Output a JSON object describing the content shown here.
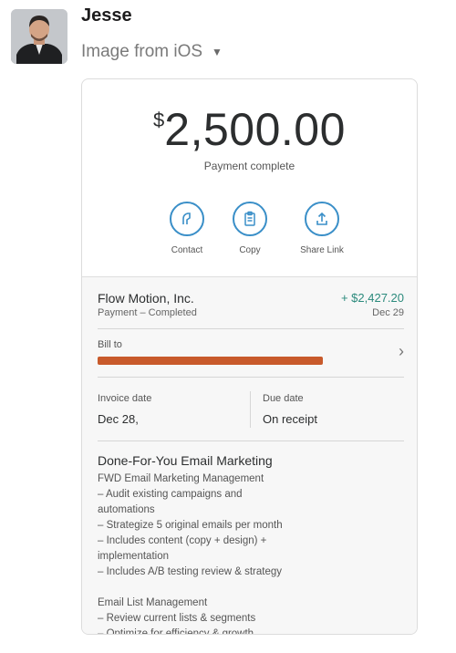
{
  "message": {
    "sender": "Jesse",
    "source": "Image from iOS",
    "caret_icon": "caret-down-icon"
  },
  "receipt": {
    "currency_symbol": "$",
    "amount": "2,500.00",
    "status": "Payment complete",
    "actions": [
      {
        "label": "Contact",
        "icon": "contact-icon"
      },
      {
        "label": "Copy",
        "icon": "copy-icon"
      },
      {
        "label": "Share Link",
        "icon": "share-icon"
      }
    ],
    "merchant": "Flow Motion, Inc.",
    "merchant_status": "Payment – Completed",
    "net_amount": "+ $2,427.20",
    "transaction_date": "Dec 29",
    "bill_to_label": "Bill to",
    "invoice_date_label": "Invoice date",
    "invoice_date": "Dec 28,",
    "due_date_label": "Due date",
    "due_date": "On receipt",
    "item_title": "Done-For-You Email Marketing",
    "description_lines": [
      "FWD Email Marketing Management",
      "– Audit existing campaigns and",
      "automations",
      "– Strategize 5 original emails per month",
      "– Includes content (copy + design) +",
      "implementation",
      "– Includes A/B testing review & strategy",
      "",
      "Email List Management",
      "– Review current lists & segments",
      "– Optimize for efficiency & growth"
    ],
    "colors": {
      "accent": "#3a8fc8",
      "positive": "#2b8a7c",
      "redaction": "#c85a2b"
    }
  }
}
